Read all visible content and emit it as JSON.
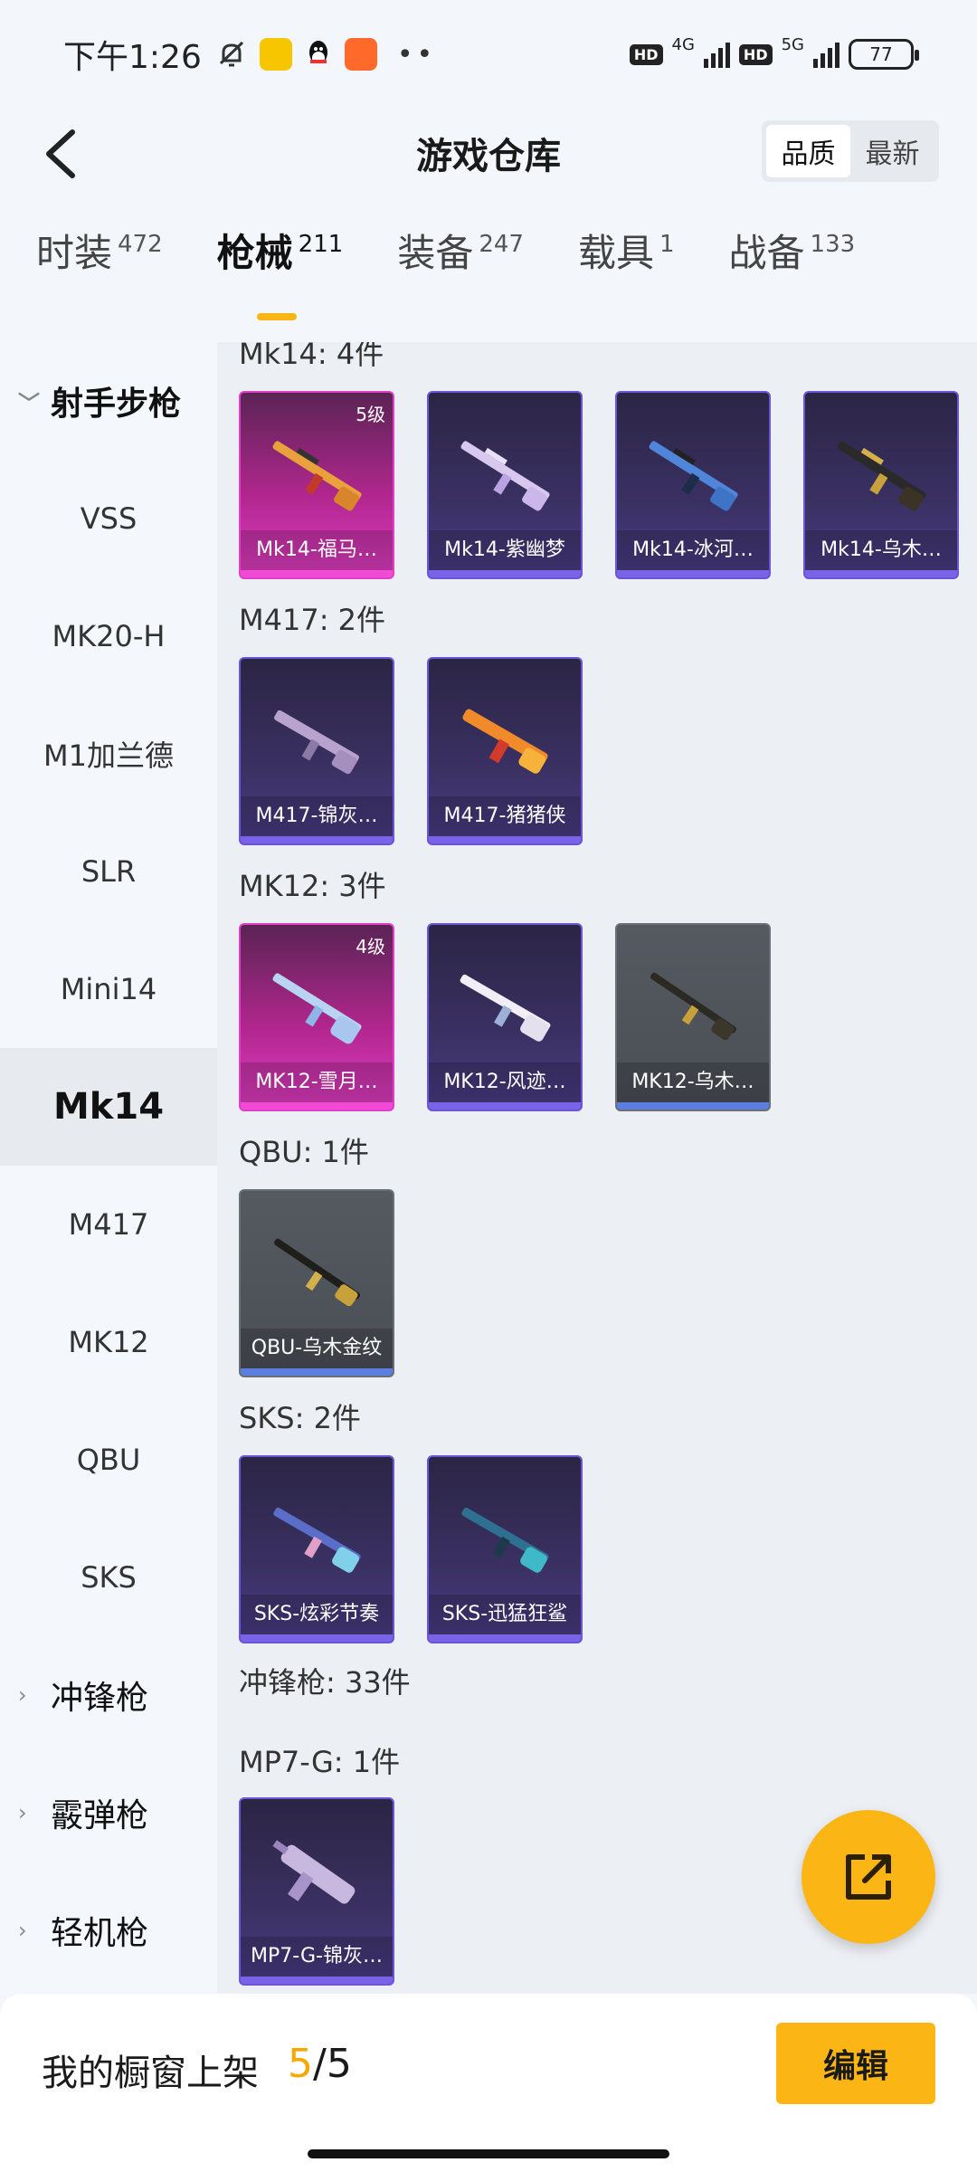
{
  "status_bar": {
    "time": "下午1:26",
    "net1": "4G",
    "net2": "5G",
    "hd1": "HD",
    "hd2": "HD",
    "battery": "77"
  },
  "header": {
    "title": "游戏仓库",
    "sort_options": [
      "品质",
      "最新"
    ]
  },
  "tabs": [
    {
      "label": "时装",
      "count": "472"
    },
    {
      "label": "枪械",
      "count": "211"
    },
    {
      "label": "装备",
      "count": "247"
    },
    {
      "label": "载具",
      "count": "1"
    },
    {
      "label": "战备",
      "count": "133"
    }
  ],
  "sidebar": {
    "group_open": "射手步枪",
    "items": [
      "VSS",
      "MK20-H",
      "M1加兰德",
      "SLR",
      "Mini14",
      "Mk14",
      "M417",
      "MK12",
      "QBU",
      "SKS"
    ],
    "groups_closed": [
      "冲锋枪",
      "霰弹枪",
      "轻机枪"
    ]
  },
  "sections": [
    {
      "title": "Mk14: 4件",
      "cards": [
        {
          "label": "Mk14-福马…",
          "level": "5级",
          "rarity": "pink"
        },
        {
          "label": "Mk14-紫幽梦",
          "rarity": "purple"
        },
        {
          "label": "Mk14-冰河…",
          "rarity": "purple"
        },
        {
          "label": "Mk14-乌木…",
          "rarity": "purple"
        }
      ]
    },
    {
      "title": "M417: 2件",
      "cards": [
        {
          "label": "M417-锦灰…",
          "rarity": "purple"
        },
        {
          "label": "M417-猪猪侠",
          "rarity": "purple"
        }
      ]
    },
    {
      "title": "MK12: 3件",
      "cards": [
        {
          "label": "MK12-雪月…",
          "level": "4级",
          "rarity": "pink"
        },
        {
          "label": "MK12-风迹…",
          "rarity": "purple"
        },
        {
          "label": "MK12-乌木…",
          "rarity": "gray"
        }
      ]
    },
    {
      "title": "QBU: 1件",
      "cards": [
        {
          "label": "QBU-乌木金纹",
          "rarity": "gray"
        }
      ]
    },
    {
      "title": "SKS: 2件",
      "cards": [
        {
          "label": "SKS-炫彩节奏",
          "rarity": "purple"
        },
        {
          "label": "SKS-迅猛狂鲨",
          "rarity": "purple"
        }
      ]
    },
    {
      "title": "冲锋枪: 33件",
      "cards": []
    },
    {
      "title": "MP7-G: 1件",
      "cards": [
        {
          "label": "MP7-G-锦灰…",
          "rarity": "purple"
        }
      ]
    }
  ],
  "footer": {
    "label": "我的橱窗上架",
    "current": "5",
    "total": "/5",
    "edit_label": "编辑"
  },
  "colors": {
    "accent": "#fbb615",
    "pink_rarity": "#e040c8",
    "purple_rarity": "#6d55d8",
    "gray_rarity": "#5b7fe0"
  }
}
